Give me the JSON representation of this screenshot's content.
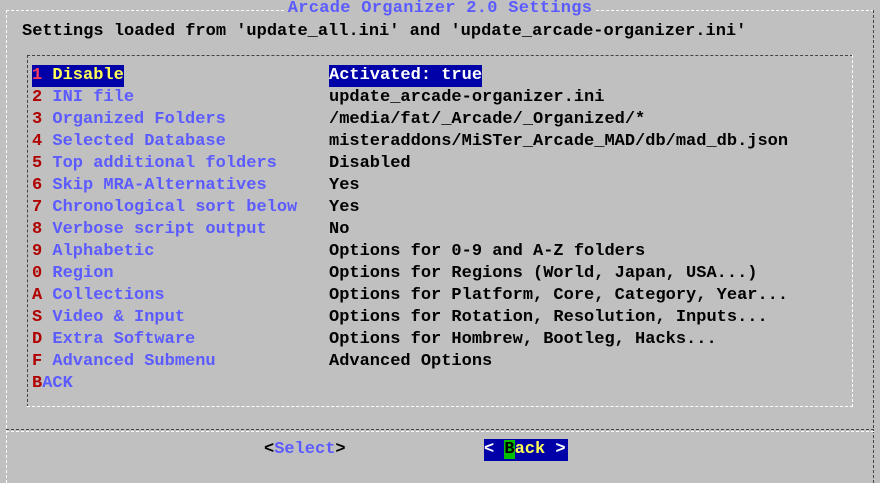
{
  "dialog": {
    "title": "Arcade Organizer 2.0 Settings",
    "header": "Settings loaded from 'update_all.ini' and 'update_arcade-organizer.ini'"
  },
  "menu": {
    "items": [
      {
        "key": "1",
        "label": " Disable",
        "value": "Activated: true",
        "selected": true
      },
      {
        "key": "2",
        "label": " INI file",
        "value": "update_arcade-organizer.ini"
      },
      {
        "key": "3",
        "label": " Organized Folders",
        "value": "/media/fat/_Arcade/_Organized/*"
      },
      {
        "key": "4",
        "label": " Selected Database",
        "value": "misteraddons/MiSTer_Arcade_MAD/db/mad_db.json"
      },
      {
        "key": "5",
        "label": " Top additional folders",
        "value": "Disabled"
      },
      {
        "key": "6",
        "label": " Skip MRA-Alternatives",
        "value": "Yes"
      },
      {
        "key": "7",
        "label": " Chronological sort below",
        "value": "Yes"
      },
      {
        "key": "8",
        "label": " Verbose script output",
        "value": "No"
      },
      {
        "key": "9",
        "label": " Alphabetic",
        "value": "Options for 0-9 and A-Z folders"
      },
      {
        "key": "0",
        "label": " Region",
        "value": "Options for Regions (World, Japan, USA...)"
      },
      {
        "key": "A",
        "label": " Collections",
        "value": "Options for Platform, Core, Category, Year..."
      },
      {
        "key": "S",
        "label": " Video & Input",
        "value": "Options for Rotation, Resolution, Inputs..."
      },
      {
        "key": "D",
        "label": " Extra Software",
        "value": "Options for Hombrew, Bootleg, Hacks..."
      },
      {
        "key": "F",
        "label": " Advanced Submenu",
        "value": "Advanced Options"
      },
      {
        "key": "B",
        "label": "ACK",
        "value": ""
      }
    ]
  },
  "buttons": {
    "select": {
      "open": "<",
      "hot": "S",
      "rest": "elect",
      "close": ">"
    },
    "back": {
      "open": "< ",
      "hot": "B",
      "rest": "ack",
      "close": " >"
    }
  },
  "colors": {
    "background": "#c0c0c0",
    "selection": "#0000a8",
    "tag_label": "#5b5bff",
    "hotkey": "#b00000",
    "title": "#5b5bff"
  }
}
